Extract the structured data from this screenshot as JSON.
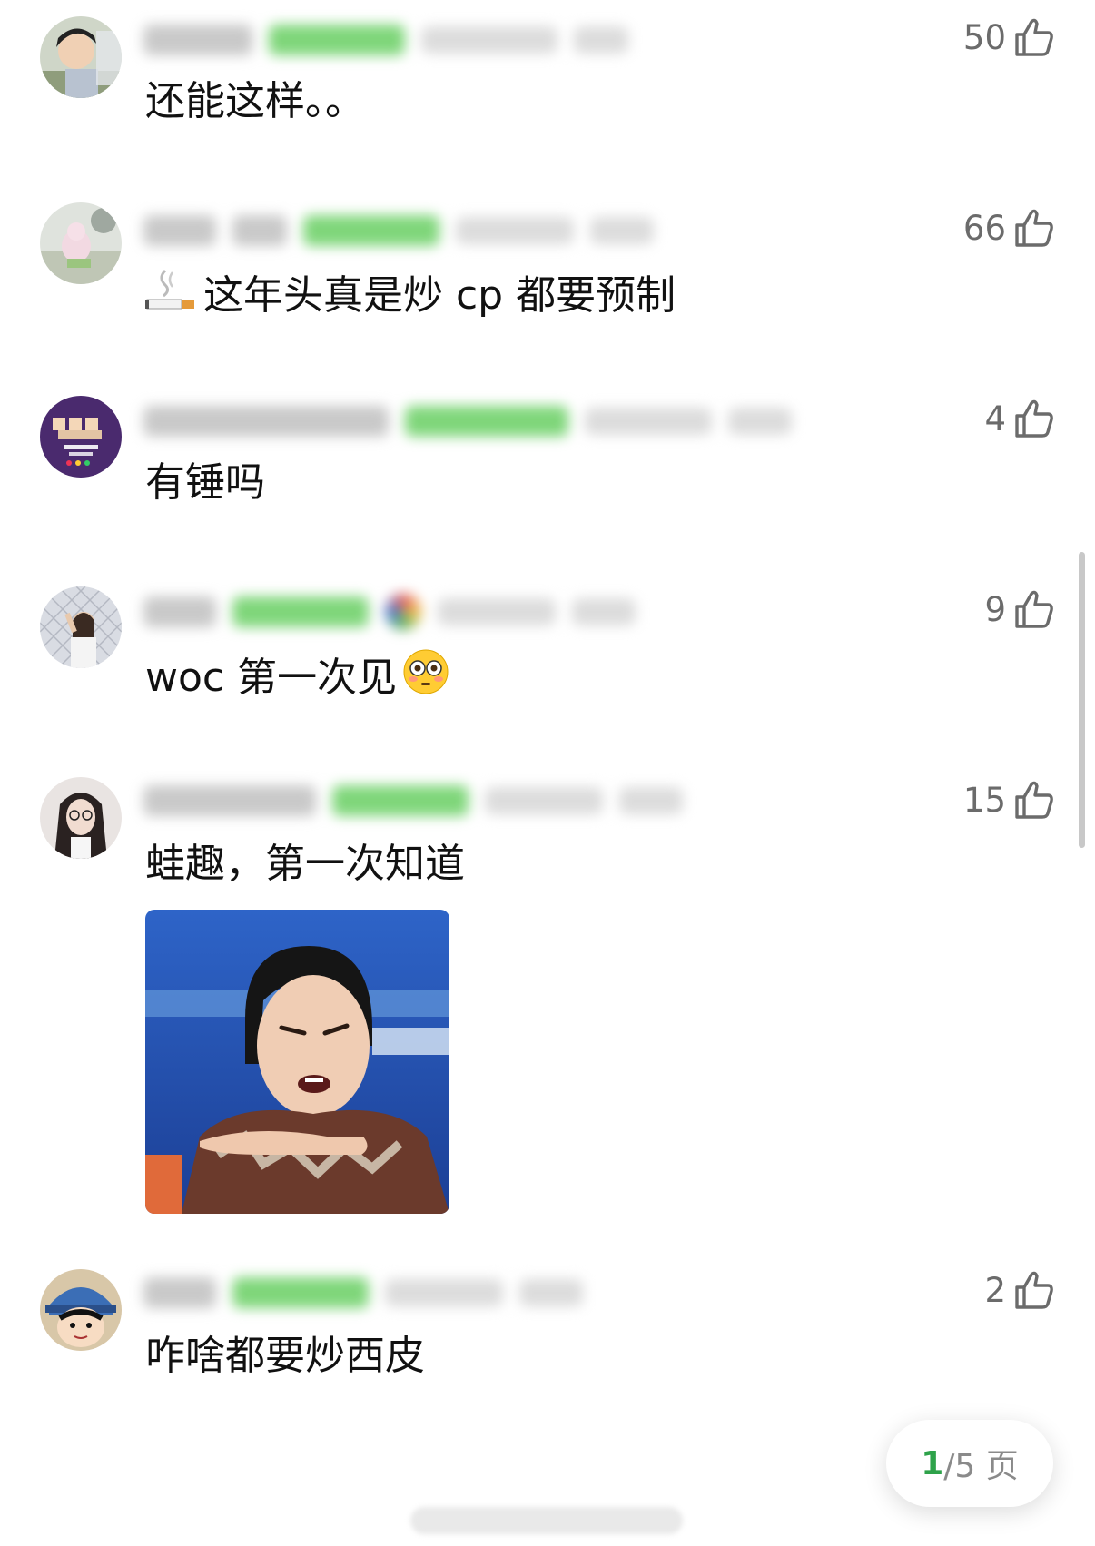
{
  "comments": [
    {
      "likes": "50",
      "text": "还能这样。。"
    },
    {
      "likes": "66",
      "emoji_icon": "cigarette-icon",
      "text": "这年头真是炒 cp 都要预制"
    },
    {
      "likes": "4",
      "text": "有锤吗"
    },
    {
      "likes": "9",
      "text": "woc 第一次见",
      "emoji_icon": "flushed-face-icon"
    },
    {
      "likes": "15",
      "text": "蛙趣，第一次知道",
      "image": "reaction-meme"
    },
    {
      "likes": "2",
      "text": "咋啥都要炒西皮"
    }
  ],
  "pager": {
    "current": "1",
    "total": "/5 页"
  },
  "colors": {
    "accent": "#2ea24a",
    "like_gray": "#6b6b6b",
    "badge_green": "#7fd67a"
  }
}
